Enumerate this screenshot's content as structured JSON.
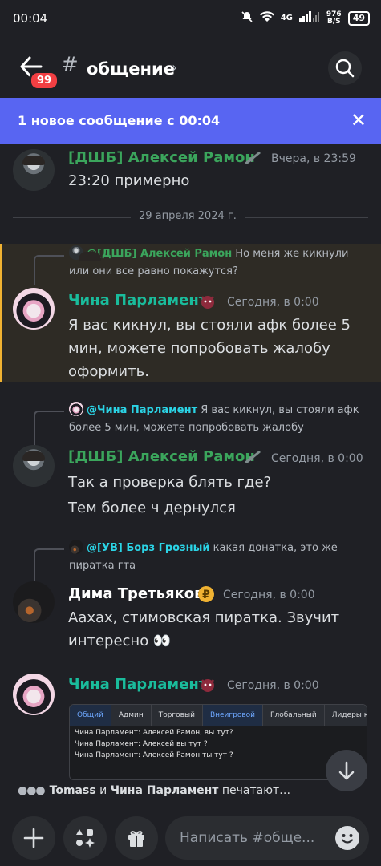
{
  "status_bar": {
    "time": "00:04",
    "network": "4G",
    "speed_value": "976",
    "speed_unit": "B/S",
    "battery": "49"
  },
  "header": {
    "unread_badge": "99",
    "channel_name": "общение"
  },
  "banner": {
    "text": "1 новое сообщение с 00:04"
  },
  "messages": [
    {
      "author": "[ДШБ] Алексей Рамон",
      "timestamp": "Вчера, в 23:59",
      "lines": [
        "23:20 примерно"
      ]
    }
  ],
  "date_divider": "29 апреля 2024 г.",
  "thread": [
    {
      "reply_to_name": "@[ДШБ] Алексей Рамон",
      "reply_text_1": "Но меня же кикнули",
      "reply_text_2": "или они все равно покажутся?",
      "author": "Чина Парламент",
      "timestamp": "Сегодня, в 0:00",
      "lines": [
        "Я вас кикнул, вы стояли афк более 5",
        "мин,  можете попробовать жалобу",
        "оформить."
      ]
    },
    {
      "reply_to_name": "@Чина Парламент",
      "reply_text_1": "Я вас кикнул, вы стояли афк",
      "reply_text_2": "более 5 мин,  можете попробовать жалобу",
      "author": "[ДШБ] Алексей Рамон",
      "timestamp": "Сегодня, в 0:00",
      "lines": [
        "Так а проверка блять где?",
        "Тем более ч  дернулся"
      ]
    },
    {
      "reply_to_name": "@[УВ] Борз Грозный",
      "reply_text_1": "какая донатка, это же",
      "reply_text_2": "пиратка гта",
      "author": "Дима Третьяков",
      "timestamp": "Сегодня, в 0:00",
      "lines": [
        "Аахах, стимовская пиратка. Звучит",
        "интересно 👀"
      ]
    },
    {
      "author": "Чина Парламент",
      "timestamp": "Сегодня, в 0:00"
    }
  ],
  "embed": {
    "tabs": [
      "Общий",
      "Админ",
      "Торговый",
      "Внеигровой",
      "Глобальный",
      "Лидеры кл..."
    ],
    "lines": [
      "Чина Парламент: Алексей Рамон, вы тут?",
      "Чина Парламент: Алексей вы тут ?",
      "Чина Парламент: Алексей Рамон ты тут ?"
    ]
  },
  "typing": {
    "user1": "Tomass",
    "and": "и",
    "user2": "Чина Парламент",
    "suffix": "печатают…"
  },
  "composer": {
    "placeholder": "Написать #обще..."
  },
  "colors": {
    "banner": "#5865f2",
    "role_green": "#3ba55c",
    "role_cyan": "#1abc9c",
    "badge_red": "#f23f43",
    "mention_highlight": "#f0b232"
  }
}
